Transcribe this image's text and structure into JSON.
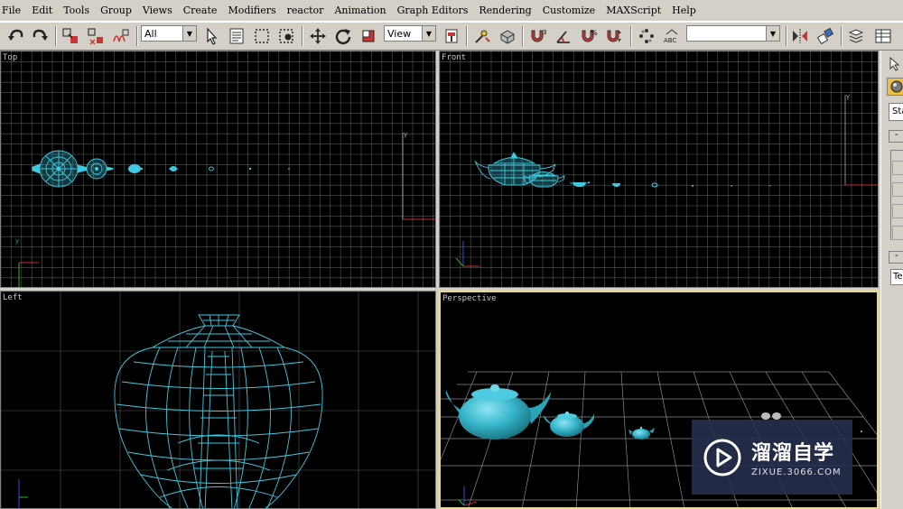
{
  "menu": [
    "File",
    "Edit",
    "Tools",
    "Group",
    "Views",
    "Create",
    "Modifiers",
    "reactor",
    "Animation",
    "Graph Editors",
    "Rendering",
    "Customize",
    "MAXScript",
    "Help"
  ],
  "toolbar": {
    "selection_filter": "All",
    "reference_coord": "View",
    "named_selection": ""
  },
  "viewports": {
    "top": "Top",
    "front": "Front",
    "left": "Left",
    "perspective": "Perspective"
  },
  "command_panel": {
    "field1": "Sta",
    "field2": "Te"
  },
  "watermark": {
    "title": "溜溜自学",
    "url": "ZIXUE.3066.COM"
  },
  "colors": {
    "wire": "#3ec9e0",
    "grid": "#5a5a5a",
    "active_border": "#e6d890"
  }
}
